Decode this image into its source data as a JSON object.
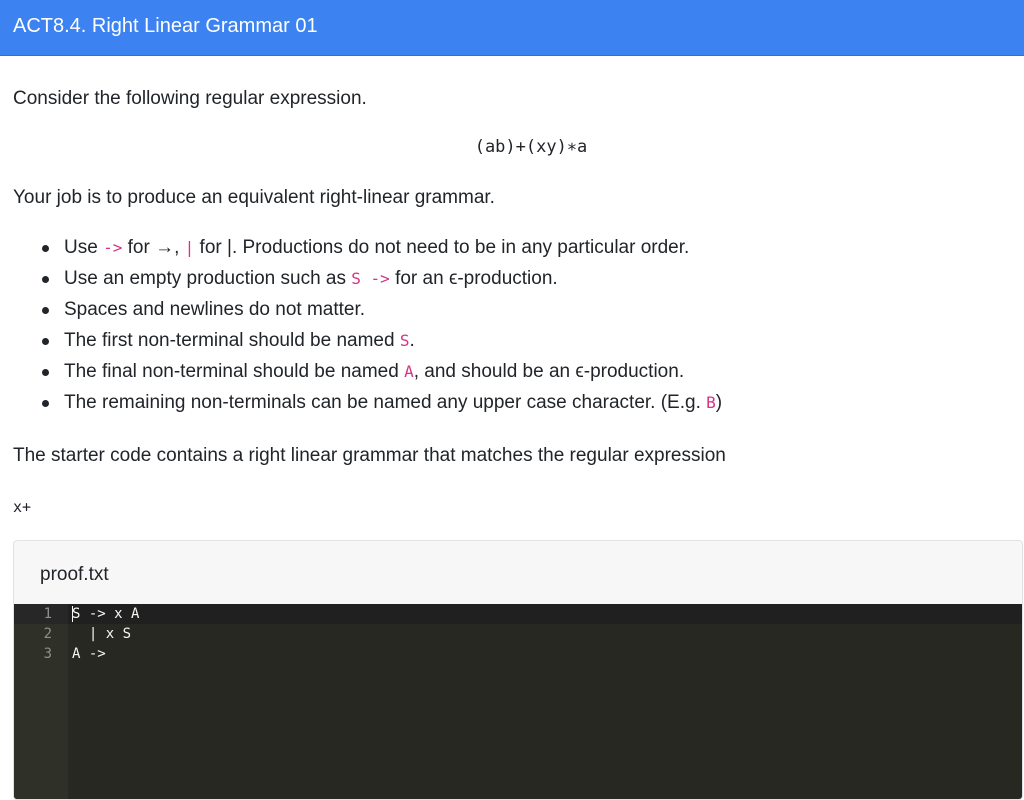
{
  "header": {
    "title": "ACT8.4. Right Linear Grammar 01"
  },
  "intro": "Consider the following regular expression.",
  "regex": "(ab)+(xy)∗a",
  "task": "Your job is to produce an equivalent right-linear grammar.",
  "bullets": {
    "b1": {
      "t1": "Use ",
      "c1": "->",
      "t2": " for →, ",
      "c2": "|",
      "t3": " for |. Productions do not need to be in any particular order."
    },
    "b2": {
      "t1": "Use an empty production such as ",
      "c1": "S ->",
      "t2": " for an ϵ-production."
    },
    "b3": {
      "t1": "Spaces and newlines do not matter."
    },
    "b4": {
      "t1": "The first non-terminal should be named ",
      "c1": "S",
      "t2": "."
    },
    "b5": {
      "t1": "The final non-terminal should be named ",
      "c1": "A",
      "t2": ", and should be an ϵ-production."
    },
    "b6": {
      "t1": "The remaining non-terminals can be named any upper case character. (E.g. ",
      "c1": "B",
      "t2": ")"
    }
  },
  "starter_text": "The starter code contains a right linear grammar that matches the regular expression",
  "starter_regex": "x+",
  "editor": {
    "filename": "proof.txt",
    "line_numbers": [
      "1",
      "2",
      "3"
    ],
    "lines": [
      "S -> x A",
      "  | x S",
      "A ->"
    ]
  },
  "colors": {
    "header_bg": "#3c82f0",
    "code_pink": "#d63384",
    "editor_bg": "#272822"
  }
}
